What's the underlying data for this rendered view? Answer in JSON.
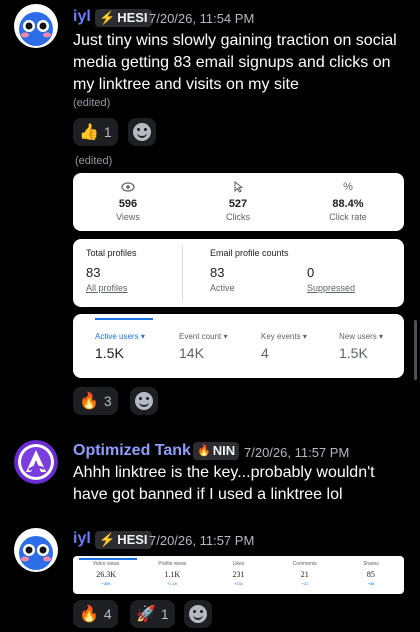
{
  "messages": [
    {
      "author": "iyl",
      "tag": "HESI",
      "tag_icon": "lightning-icon",
      "timestamp": "7/20/26, 11:54 PM",
      "text": "Just tiny wins slowly gaining traction on social media getting 83 email signups and clicks on my linktree and visits on my site",
      "edited": "(edited)",
      "reactions": [
        {
          "emoji": "👍",
          "count": "1"
        }
      ],
      "attachment_edited": "(edited)",
      "link_stats": [
        {
          "icon": "eye-icon",
          "value": "596",
          "label": "Views"
        },
        {
          "icon": "cursor-icon",
          "value": "527",
          "label": "Clicks"
        },
        {
          "icon": "percent-icon",
          "value": "88.4%",
          "label": "Click rate"
        }
      ],
      "profiles": {
        "total_label": "Total profiles",
        "total_value": "83",
        "total_link": "All profiles",
        "email_label": "Email profile counts",
        "active_value": "83",
        "active_label": "Active",
        "suppressed_value": "0",
        "suppressed_label": "Suppressed"
      },
      "analytics": [
        {
          "label": "Active users",
          "value": "1.5K"
        },
        {
          "label": "Event count",
          "value": "14K"
        },
        {
          "label": "Key events",
          "value": "4"
        },
        {
          "label": "New users",
          "value": "1.5K"
        }
      ],
      "attachment_reactions": [
        {
          "emoji": "🔥",
          "count": "3"
        }
      ]
    },
    {
      "author": "Optimized Tank",
      "tag": "NIN",
      "tag_icon": "fire-icon",
      "timestamp": "7/20/26, 11:57 PM",
      "text": "Ahhh linktree is the key...probably wouldn't have got banned if I used a linktree lol"
    },
    {
      "author": "iyl",
      "tag": "HESI",
      "tag_icon": "lightning-icon",
      "timestamp": "7/20/26, 11:57 PM",
      "social_stats": [
        {
          "label": "Video views",
          "value": "26.3K",
          "delta": "+26K"
        },
        {
          "label": "Profile views",
          "value": "1.1K",
          "delta": "+1.1K"
        },
        {
          "label": "Likes",
          "value": "231",
          "delta": "+231"
        },
        {
          "label": "Comments",
          "value": "21",
          "delta": "+21"
        },
        {
          "label": "Shares",
          "value": "85",
          "delta": "+85"
        }
      ],
      "reactions": [
        {
          "emoji": "🔥",
          "count": "4"
        },
        {
          "emoji": "🚀",
          "count": "1"
        }
      ]
    }
  ],
  "colors": {
    "background": "#000000",
    "name_iyl": "#5865f2",
    "name_tank": "#7289da",
    "analytics_accent": "#1a73e8"
  }
}
